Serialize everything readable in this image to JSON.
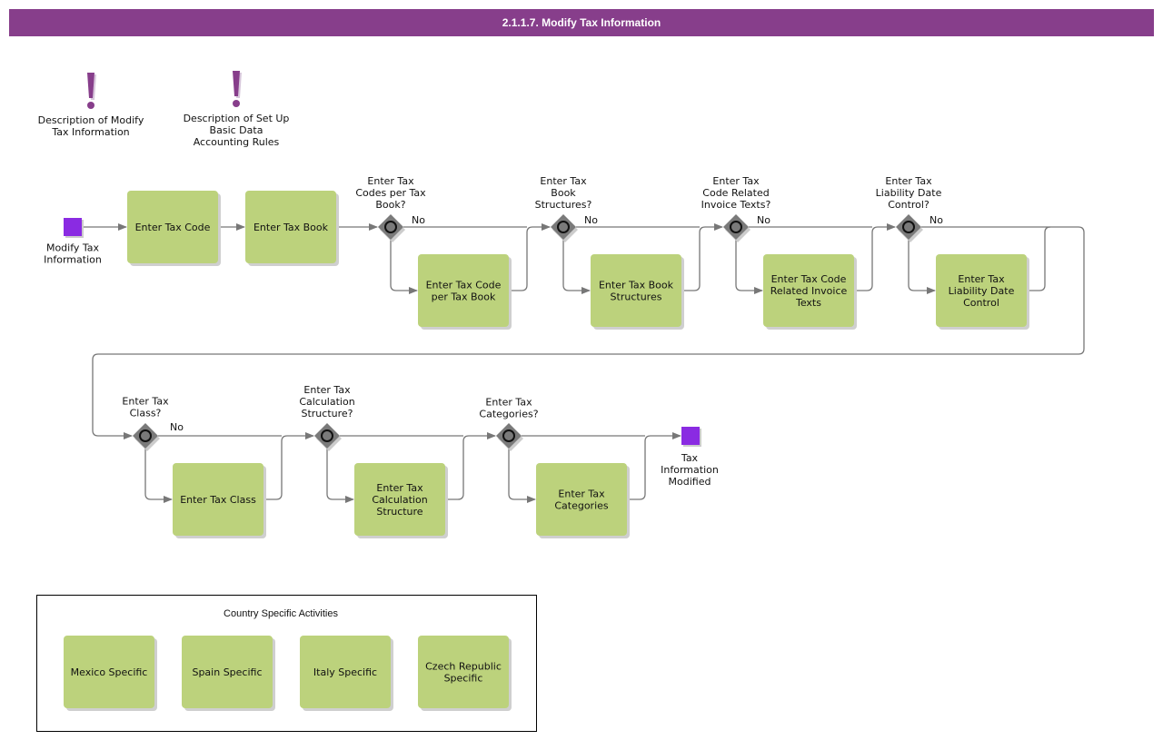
{
  "header": {
    "title": "2.1.1.7. Modify Tax Information"
  },
  "colors": {
    "title_bar": "#873E8B",
    "task": "#BCD27C",
    "event": "#8A2BE2",
    "gateway": "#7A7A7A",
    "flow": "#777777"
  },
  "notes": [
    {
      "icon": "exclamation-icon",
      "label_lines": [
        "Description of Modify",
        "Tax Information"
      ]
    },
    {
      "icon": "exclamation-icon",
      "label_lines": [
        "Description of Set Up",
        "Basic Data",
        "Accounting Rules"
      ]
    }
  ],
  "start_event": {
    "label_lines": [
      "Modify Tax",
      "Information"
    ]
  },
  "end_event": {
    "label_lines": [
      "Tax",
      "Information",
      "Modified"
    ]
  },
  "tasks_main": [
    {
      "id": "enter-tax-code",
      "lines": [
        "Enter Tax Code"
      ]
    },
    {
      "id": "enter-tax-book",
      "lines": [
        "Enter Tax Book"
      ]
    }
  ],
  "gateways": [
    {
      "id": "gw-codes-per-book",
      "question": [
        "Enter Tax",
        "Codes per Tax",
        "Book?"
      ],
      "no_label": "No",
      "task": {
        "id": "enter-tax-code-per-tax-book",
        "lines": [
          "Enter Tax Code",
          "per Tax Book"
        ]
      }
    },
    {
      "id": "gw-book-structures",
      "question": [
        "Enter Tax",
        "Book",
        "Structures?"
      ],
      "no_label": "No",
      "task": {
        "id": "enter-tax-book-structures",
        "lines": [
          "Enter Tax Book",
          "Structures"
        ]
      }
    },
    {
      "id": "gw-invoice-texts",
      "question": [
        "Enter Tax",
        "Code Related",
        "Invoice Texts?"
      ],
      "no_label": "No",
      "task": {
        "id": "enter-tax-code-related-invoice-texts",
        "lines": [
          "Enter Tax Code",
          "Related Invoice",
          "Texts"
        ]
      }
    },
    {
      "id": "gw-liability-date",
      "question": [
        "Enter Tax",
        "Liability Date",
        "Control?"
      ],
      "no_label": "No",
      "task": {
        "id": "enter-tax-liability-date-control",
        "lines": [
          "Enter Tax",
          "Liability Date",
          "Control"
        ]
      }
    },
    {
      "id": "gw-tax-class",
      "question": [
        "Enter Tax",
        "Class?"
      ],
      "no_label": "No",
      "task": {
        "id": "enter-tax-class",
        "lines": [
          "Enter Tax Class"
        ]
      }
    },
    {
      "id": "gw-calc-structure",
      "question": [
        "Enter Tax",
        "Calculation",
        "Structure?"
      ],
      "no_label": "",
      "task": {
        "id": "enter-tax-calculation-structure",
        "lines": [
          "Enter Tax",
          "Calculation",
          "Structure"
        ]
      }
    },
    {
      "id": "gw-categories",
      "question": [
        "Enter Tax",
        "Categories?"
      ],
      "no_label": "",
      "task": {
        "id": "enter-tax-categories",
        "lines": [
          "Enter Tax",
          "Categories"
        ]
      }
    }
  ],
  "country_group": {
    "title": "Country Specific Activities",
    "items": [
      {
        "id": "mexico-specific",
        "lines": [
          "Mexico Specific"
        ]
      },
      {
        "id": "spain-specific",
        "lines": [
          "Spain Specific"
        ]
      },
      {
        "id": "italy-specific",
        "lines": [
          "Italy Specific"
        ]
      },
      {
        "id": "czech-republic-specific",
        "lines": [
          "Czech Republic",
          "Specific"
        ]
      }
    ]
  }
}
